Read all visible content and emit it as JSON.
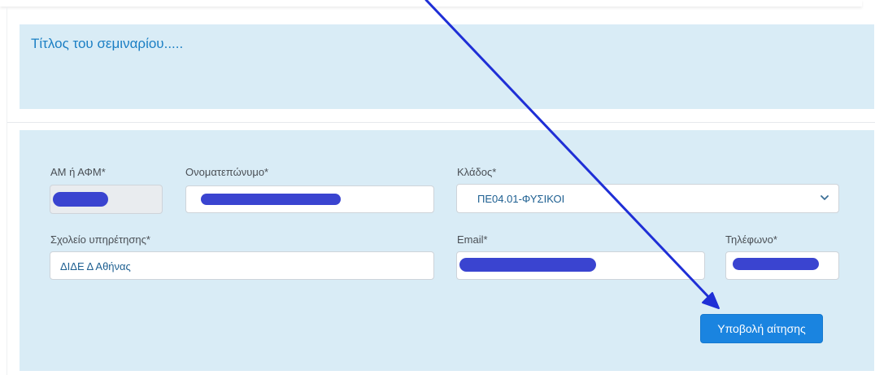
{
  "seminar": {
    "title": "Τίτλος του σεμιναρίου....."
  },
  "form": {
    "am_label": "ΑΜ ή ΑΦΜ*",
    "name_label": "Ονοματεπώνυμο*",
    "klados_label": "Κλάδος*",
    "klados_value": "ΠΕ04.01-ΦΥΣΙΚΟΙ",
    "school_label": "Σχολείο υπηρέτησης*",
    "school_value": "ΔΙΔΕ Δ Αθήνας",
    "email_label": "Email*",
    "phone_label": "Τηλέφωνο*",
    "submit_label": "Υποβολή αίτησης"
  },
  "colors": {
    "panel": "#d9ecf6",
    "accent": "#1b7fc4",
    "button": "#1a84e0",
    "annotation": "#1f2fd6",
    "redaction": "#3a44d0"
  },
  "icons": {
    "select_caret": "chevron-down-icon",
    "annotation": "arrow-annotation"
  }
}
